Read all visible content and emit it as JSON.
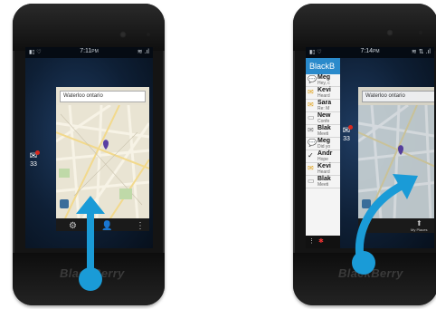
{
  "left_phone": {
    "status_time": "7:11",
    "status_time_suffix": "PM",
    "search_text": "Waterloo ontario",
    "hub_count": "33",
    "brand": "BlackBerry"
  },
  "right_phone": {
    "status_time": "7:14",
    "status_time_suffix": "PM",
    "search_text": "Waterloo ontario",
    "hub_title": "BlackB",
    "hub_count": "33",
    "brand": "BlackBerry",
    "action_label": "My Places",
    "messages": [
      {
        "name": "Meg",
        "preview": "Hey, c",
        "icon": "bbm-icon"
      },
      {
        "name": "Kevi",
        "preview": "Heard",
        "icon": "email-icon"
      },
      {
        "name": "Sara",
        "preview": "Re: M",
        "icon": "email-icon"
      },
      {
        "name": "New",
        "preview": "Confe",
        "icon": "sms-icon"
      },
      {
        "name": "Blak",
        "preview": "Meeti",
        "icon": "email-open-icon"
      },
      {
        "name": "Meg",
        "preview": "Did yo",
        "icon": "bbm-icon"
      },
      {
        "name": "Andr",
        "preview": "Hope",
        "icon": "check-icon"
      },
      {
        "name": "Kevi",
        "preview": "Heard",
        "icon": "email-icon"
      },
      {
        "name": "Blak",
        "preview": "Meeti",
        "icon": "sms-icon"
      }
    ]
  },
  "colors": {
    "arrow": "#1a9bd7",
    "hub_header": "#2a8acb",
    "phone_body": "#141414"
  }
}
